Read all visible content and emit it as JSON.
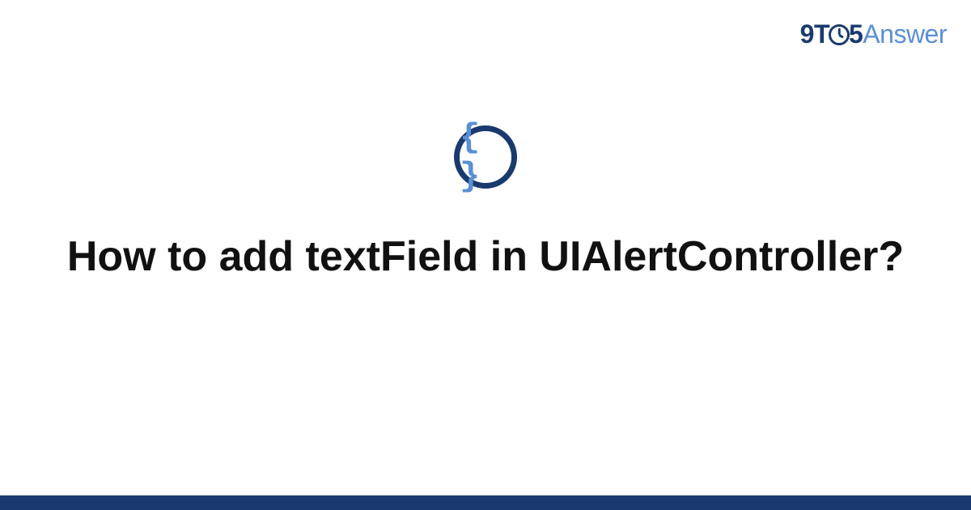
{
  "logo": {
    "nine": "9",
    "t": "T",
    "five": "5",
    "answer": "Answer"
  },
  "center_icon": {
    "braces": "{ }"
  },
  "question": "How to add textField in UIAlertController?",
  "colors": {
    "accent_dark": "#1a3a6e",
    "accent_light": "#5a8fd6"
  }
}
